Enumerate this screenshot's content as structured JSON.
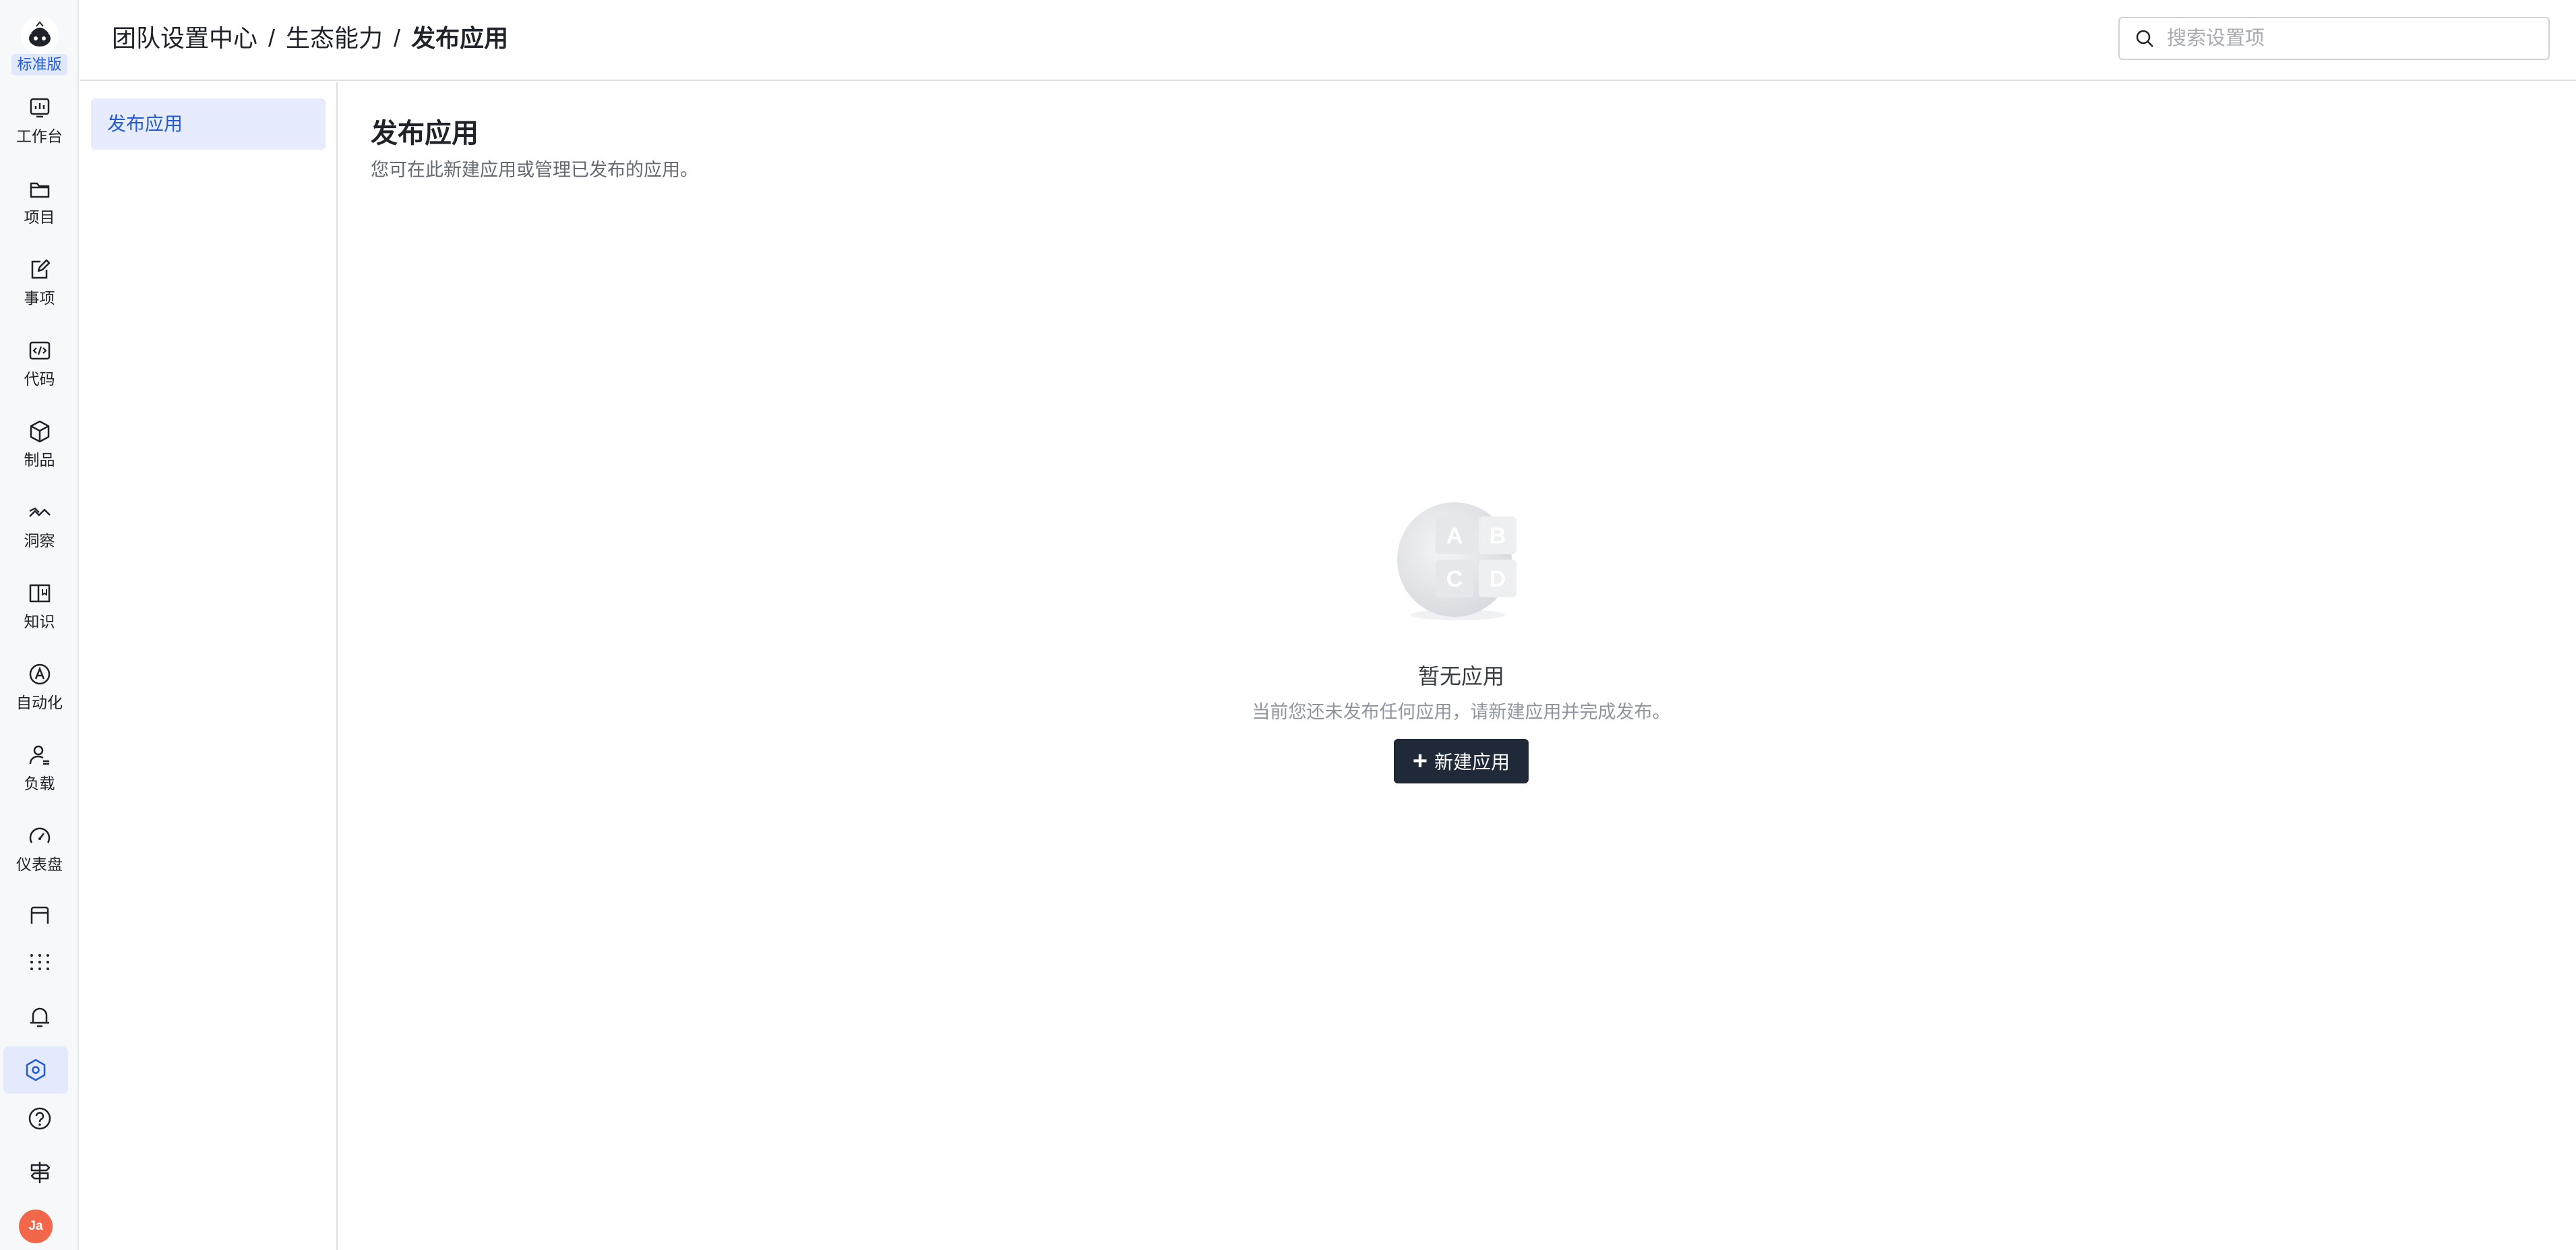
{
  "rail": {
    "edition_badge": "标准版",
    "items": [
      {
        "label": "工作台",
        "icon": "chart-board-icon"
      },
      {
        "label": "项目",
        "icon": "folder-icon"
      },
      {
        "label": "事项",
        "icon": "edit-doc-icon"
      },
      {
        "label": "代码",
        "icon": "code-icon"
      },
      {
        "label": "制品",
        "icon": "package-icon"
      },
      {
        "label": "洞察",
        "icon": "insight-icon"
      },
      {
        "label": "知识",
        "icon": "book-icon"
      },
      {
        "label": "自动化",
        "icon": "automation-icon"
      },
      {
        "label": "负载",
        "icon": "user-load-icon"
      },
      {
        "label": "仪表盘",
        "icon": "gauge-icon"
      }
    ],
    "bottom_icons": [
      "apps-grid-icon",
      "bell-icon",
      "settings-hex-icon",
      "help-icon",
      "signpost-icon"
    ],
    "avatar_text": "Ja"
  },
  "header": {
    "breadcrumb": [
      "团队设置中心",
      "生态能力",
      "发布应用"
    ],
    "separator": "/",
    "search_placeholder": "搜索设置项"
  },
  "subnav": {
    "items": [
      {
        "label": "发布应用",
        "active": true
      }
    ]
  },
  "main": {
    "title": "发布应用",
    "description": "您可在此新建应用或管理已发布的应用。",
    "empty": {
      "tiles": [
        "A",
        "B",
        "C",
        "D"
      ],
      "title": "暂无应用",
      "description": "当前您还未发布任何应用，请新建应用并完成发布。",
      "button_label": "新建应用",
      "button_icon": "+"
    }
  },
  "colors": {
    "accent": "#245bdb",
    "button_dark": "#1f2937",
    "avatar": "#f2674a"
  }
}
